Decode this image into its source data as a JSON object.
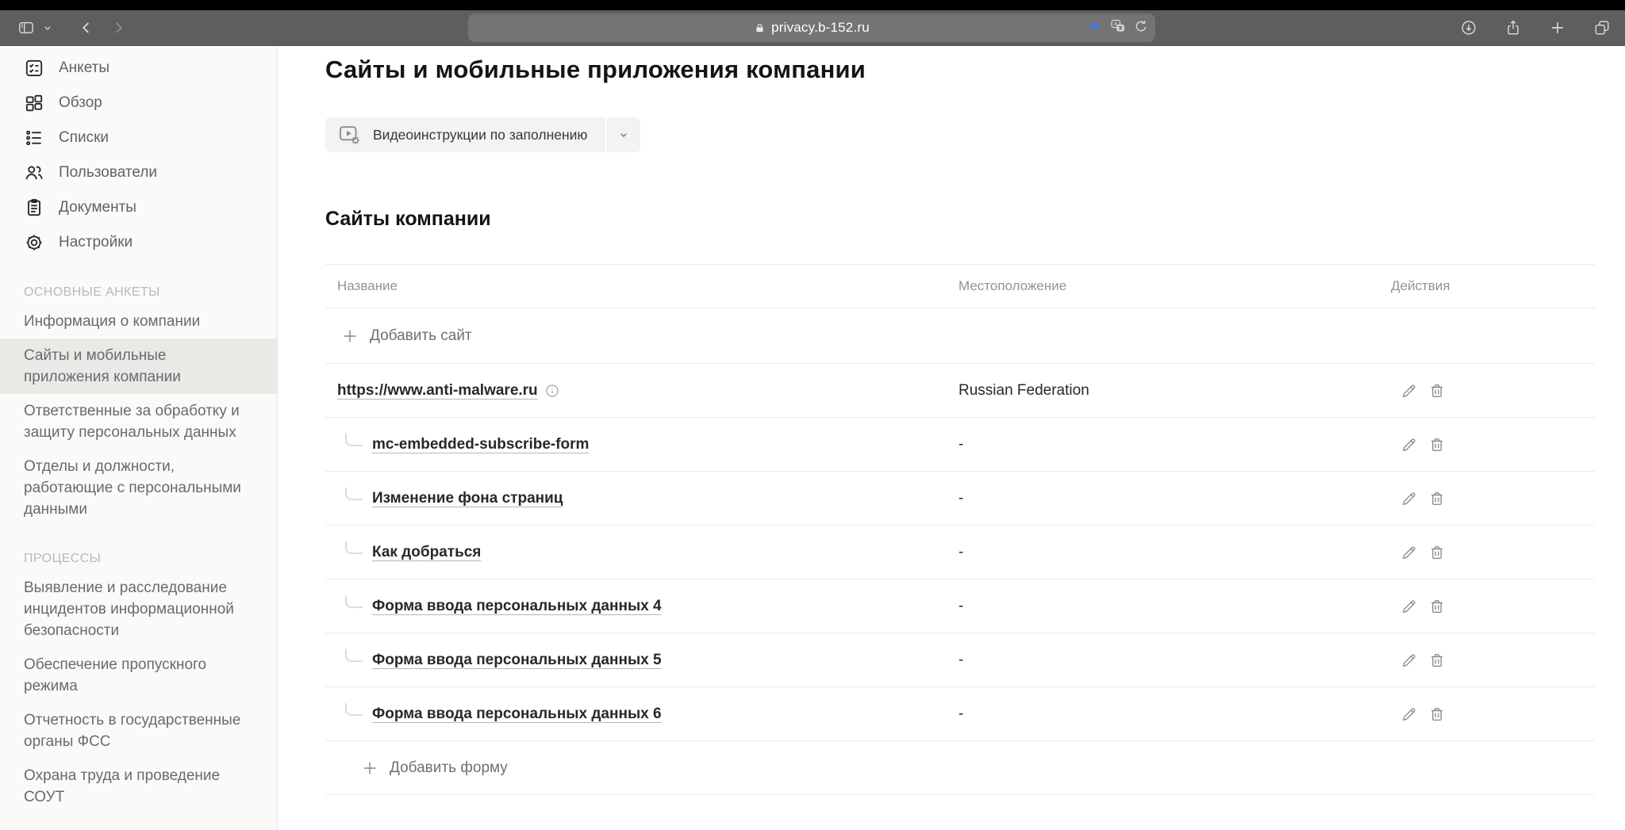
{
  "colors": {
    "toolbar_bg": "#5e5e5c",
    "audio_icon_blue": "#3b7cf6",
    "sidebar_bg": "#fafaf9",
    "sidebar_active_bg": "#e9e9e5",
    "table_border": "#eaeae8"
  },
  "browser": {
    "url": "privacy.b-152.ru",
    "left_controls": [
      "sidebar-toggle-icon",
      "chevron-down-icon",
      "back-icon",
      "forward-icon"
    ],
    "address_icons": [
      "lock-icon",
      "audio-icon",
      "translate-icon",
      "reload-icon"
    ],
    "right_controls": [
      "download-icon",
      "share-icon",
      "new-tab-icon",
      "tab-overview-icon"
    ]
  },
  "sidebar": {
    "nav": [
      {
        "icon": "checklist-icon",
        "label": "Анкеты"
      },
      {
        "icon": "dashboard-icon",
        "label": "Обзор"
      },
      {
        "icon": "list-icon",
        "label": "Списки"
      },
      {
        "icon": "users-icon",
        "label": "Пользователи"
      },
      {
        "icon": "document-icon",
        "label": "Документы"
      },
      {
        "icon": "gear-icon",
        "label": "Настройки"
      }
    ],
    "sections": [
      {
        "title": "ОСНОВНЫЕ АНКЕТЫ",
        "items": [
          {
            "label": "Информация о компании",
            "active": false
          },
          {
            "label": "Сайты и мобильные приложения компании",
            "active": true
          },
          {
            "label": "Ответственные за обработку и защиту персональных данных",
            "active": false
          },
          {
            "label": "Отделы и должности, работающие с персональными данными",
            "active": false
          }
        ]
      },
      {
        "title": "ПРОЦЕССЫ",
        "items": [
          {
            "label": "Выявление и расследование инцидентов информационной безопасности",
            "active": false
          },
          {
            "label": "Обеспечение пропускного режима",
            "active": false
          },
          {
            "label": "Отчетность в государственные органы ФСС",
            "active": false
          },
          {
            "label": "Охрана труда и проведение СОУТ",
            "active": false
          }
        ]
      }
    ]
  },
  "main": {
    "title": "Сайты и мобильные приложения компании",
    "video_button_label": "Видеоинструкции по заполнению",
    "section_title": "Сайты компании",
    "table": {
      "columns": [
        "Название",
        "Местоположение",
        "Действия"
      ],
      "add_site_label": "Добавить сайт",
      "add_form_label": "Добавить форму",
      "rows": [
        {
          "type": "site",
          "name": "https://www.anti-malware.ru",
          "location": "Russian Federation",
          "info": true
        },
        {
          "type": "form",
          "name": "mc-embedded-subscribe-form",
          "location": "-",
          "info": false
        },
        {
          "type": "form",
          "name": "Изменение фона страниц",
          "location": "-",
          "info": false
        },
        {
          "type": "form",
          "name": "Как добраться",
          "location": "-",
          "info": false
        },
        {
          "type": "form",
          "name": "Форма ввода персональных данных 4",
          "location": "-",
          "info": false
        },
        {
          "type": "form",
          "name": "Форма ввода персональных данных 5",
          "location": "-",
          "info": false
        },
        {
          "type": "form",
          "name": "Форма ввода персональных данных 6",
          "location": "-",
          "info": false
        }
      ]
    }
  }
}
